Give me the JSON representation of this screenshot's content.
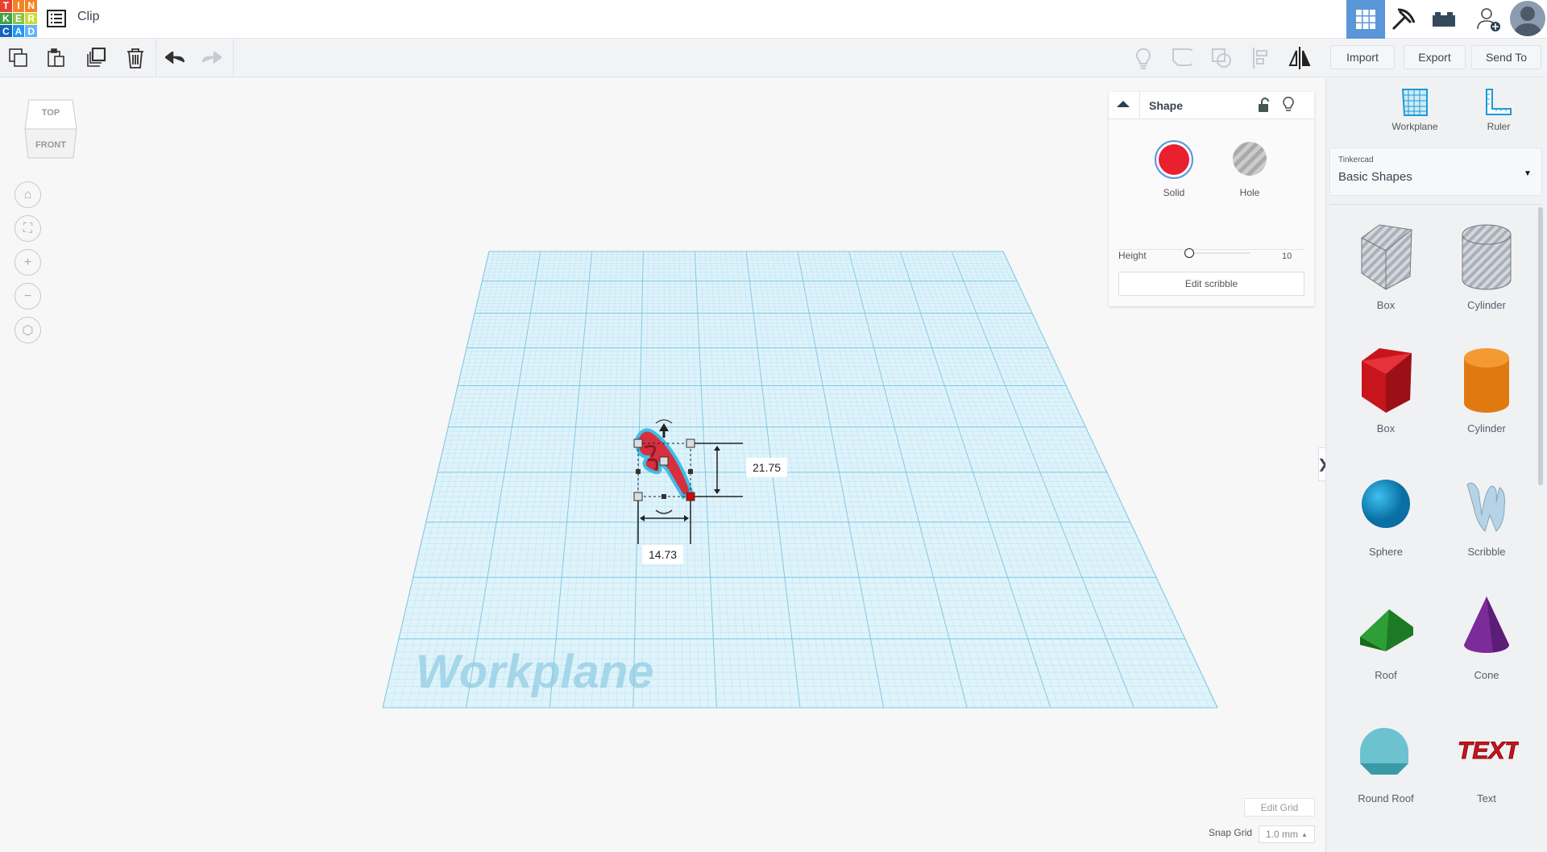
{
  "app": {
    "logo_letters": [
      "T",
      "I",
      "N",
      "K",
      "E",
      "R",
      "C",
      "A",
      "D"
    ],
    "logo_colors": [
      "#e8402f",
      "#f58325",
      "#f58325",
      "#43a047",
      "#8bc34a",
      "#cddc39",
      "#1565c0",
      "#2196f3",
      "#64b5f6"
    ],
    "title": "Clip"
  },
  "toolbar": {
    "left": [
      "copy-icon",
      "paste-icon",
      "duplicate-icon",
      "delete-icon",
      "undo-icon",
      "redo-icon"
    ],
    "right": [
      "lightbulb-icon",
      "group-icon",
      "ungroup-icon",
      "align-icon",
      "mirror-icon"
    ],
    "import": "Import",
    "export": "Export",
    "send_to": "Send To"
  },
  "header_right": {
    "items": [
      "3d-design-view-icon",
      "codeblocks-pickaxe-icon",
      "bricks-icon",
      "invite-user-icon",
      "avatar"
    ],
    "accent": "#5a96d8"
  },
  "viewcube": {
    "top": "TOP",
    "front": "FRONT"
  },
  "nav": [
    "home-icon",
    "fit-view-icon",
    "zoom-in-icon",
    "zoom-out-icon",
    "perspective-icon"
  ],
  "shape_panel": {
    "title": "Shape",
    "solid": "Solid",
    "hole": "Hole",
    "solid_color": "#e8202f",
    "height_label": "Height",
    "height_value": "10",
    "edit_button": "Edit scribble"
  },
  "canvas": {
    "workplane_label": "Workplane",
    "dim_depth": "21.75",
    "dim_width": "14.73",
    "grid_color": "#a8dcef"
  },
  "grid_controls": {
    "edit_grid": "Edit Grid",
    "snap_label": "Snap Grid",
    "snap_value": "1.0 mm"
  },
  "library": {
    "workplane": "Workplane",
    "ruler": "Ruler",
    "source": "Tinkercad",
    "category": "Basic Shapes",
    "shapes": [
      {
        "name": "Box",
        "kind": "box-hole"
      },
      {
        "name": "Cylinder",
        "kind": "cyl-hole"
      },
      {
        "name": "Box",
        "kind": "box"
      },
      {
        "name": "Cylinder",
        "kind": "cyl"
      },
      {
        "name": "Sphere",
        "kind": "sphere"
      },
      {
        "name": "Scribble",
        "kind": "scribble"
      },
      {
        "name": "Roof",
        "kind": "roof"
      },
      {
        "name": "Cone",
        "kind": "cone"
      },
      {
        "name": "Round Roof",
        "kind": "roundroof"
      },
      {
        "name": "Text",
        "kind": "text"
      }
    ]
  }
}
